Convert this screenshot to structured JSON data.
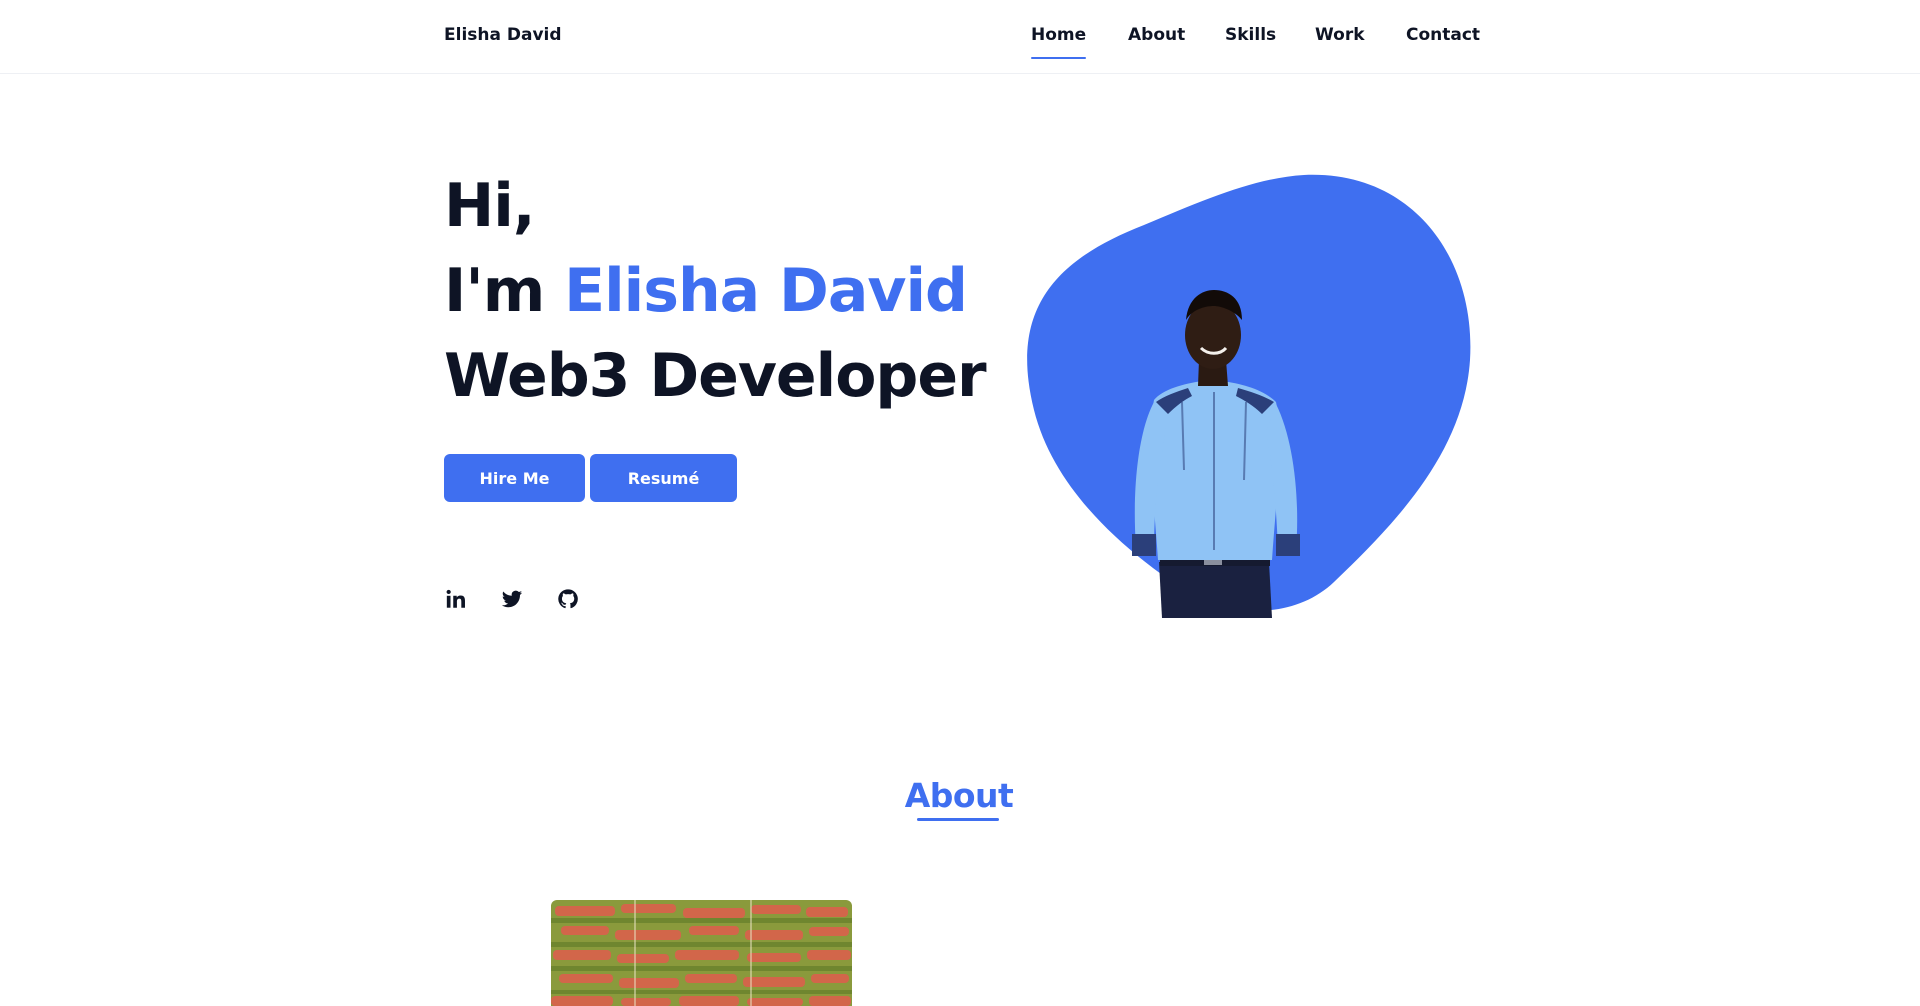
{
  "header": {
    "logo": "Elisha David",
    "nav": [
      "Home",
      "About",
      "Skills",
      "Work",
      "Contact"
    ],
    "active": "Home"
  },
  "hero": {
    "greeting": "Hi,",
    "intro_prefix": "I'm ",
    "name": "Elisha David",
    "role": "Web3 Developer",
    "buttons": {
      "hire": "Hire Me",
      "resume": "Resumé"
    },
    "socials": [
      "linkedin-icon",
      "twitter-icon",
      "github-icon"
    ]
  },
  "about": {
    "title": "About"
  },
  "colors": {
    "accent": "#3f6ff0",
    "text": "#0e1425",
    "background": "#ffffff"
  }
}
